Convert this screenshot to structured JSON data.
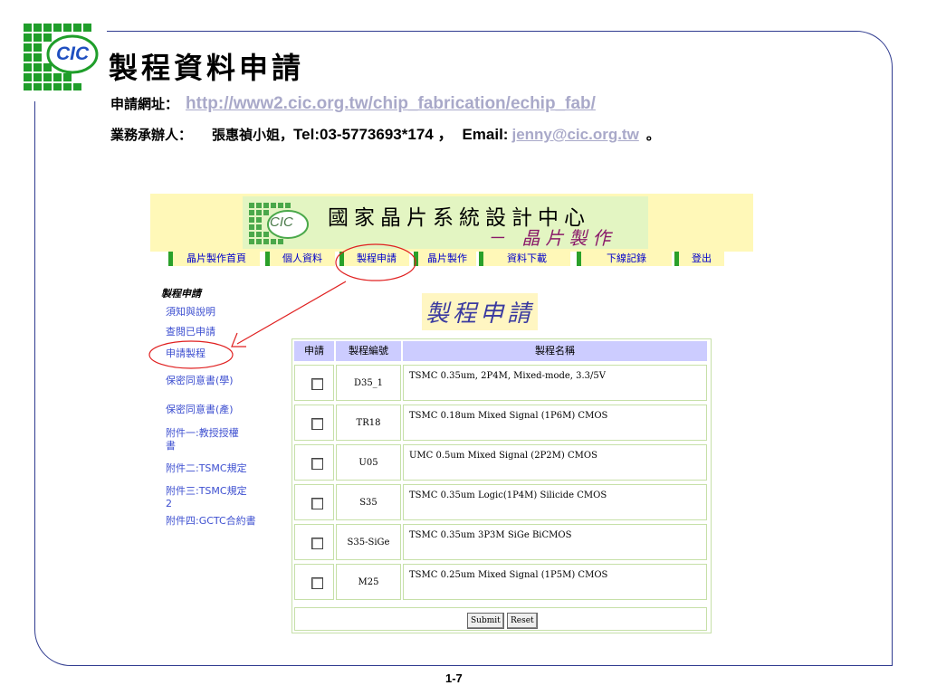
{
  "slide": {
    "title": "製程資料申請",
    "apply_url_label": "申請網址：",
    "apply_url": "http://www2.cic.org.tw/chip_fabrication/echip_fab/",
    "contact_label": "業務承辦人：",
    "contact_name": "張惠禎小姐，",
    "contact_tel": "Tel:03-5773693*174 ，",
    "contact_email_label": "Email:",
    "contact_email": "jenny@cic.org.tw",
    "contact_end": "。",
    "page_number": "1-7",
    "logo_text": "CIC"
  },
  "site": {
    "banner_logo_text": "CIC",
    "banner_title": "國家晶片系統設計中心",
    "banner_subtitle": "－ 晶片製作",
    "nav": [
      {
        "label": "晶片製作首頁"
      },
      {
        "label": "個人資料"
      },
      {
        "label": "製程申請"
      },
      {
        "label": "晶片製作"
      },
      {
        "label": "資料下載"
      },
      {
        "label": "下線記錄"
      },
      {
        "label": "登出"
      }
    ],
    "sidebar": {
      "heading": "製程申請",
      "items": [
        {
          "label": "須知與說明"
        },
        {
          "label": "查閱已申請"
        },
        {
          "label": "申請製程"
        },
        {
          "label": "保密同意書(學)"
        },
        {
          "label": "保密同意書(產)"
        },
        {
          "label": "附件一:教授授權書"
        },
        {
          "label": "附件二:TSMC規定"
        },
        {
          "label": "附件三:TSMC規定2"
        },
        {
          "label": "附件四:GCTC合約書"
        }
      ]
    },
    "page_title": "製程申請",
    "table": {
      "headers": [
        "申請",
        "製程編號",
        "製程名稱"
      ],
      "rows": [
        {
          "code": "D35_1",
          "name": "TSMC 0.35um, 2P4M, Mixed-mode, 3.3/5V"
        },
        {
          "code": "TR18",
          "name": "TSMC 0.18um Mixed Signal (1P6M) CMOS"
        },
        {
          "code": "U05",
          "name": "UMC 0.5um Mixed Signal (2P2M) CMOS"
        },
        {
          "code": "S35",
          "name": "TSMC 0.35um Logic(1P4M) Silicide CMOS"
        },
        {
          "code": "S35-SiGe",
          "name": "TSMC 0.35um 3P3M SiGe BiCMOS"
        },
        {
          "code": "M25",
          "name": "TSMC 0.25um Mixed Signal (1P5M) CMOS"
        }
      ]
    },
    "submit_label": "Submit",
    "reset_label": "Reset"
  },
  "colors": {
    "accent_green": "#2aa02a",
    "link_blue": "#3d4fd0",
    "annotation_red": "#e02020",
    "frame_blue": "#2f3b8f"
  }
}
